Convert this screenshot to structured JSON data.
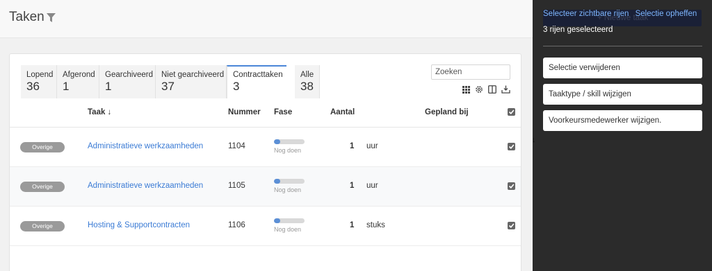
{
  "header": {
    "title": "Taken"
  },
  "tabs": [
    {
      "label": "Lopend",
      "count": "36"
    },
    {
      "label": "Afgerond",
      "count": "1"
    },
    {
      "label": "Gearchiveerd",
      "count": "1"
    },
    {
      "label": "Niet gearchiveerd",
      "count": "37"
    },
    {
      "label": "Contracttaken",
      "count": "3"
    },
    {
      "label": "Alle",
      "count": "38"
    }
  ],
  "active_tab": "Contracttaken",
  "search": {
    "placeholder": "Zoeken",
    "value": ""
  },
  "toolbar_icons": [
    "grid-icon",
    "gear-icon",
    "columns-icon",
    "export-icon"
  ],
  "table": {
    "headers": {
      "taak": "Taak ↓",
      "nummer": "Nummer",
      "fase": "Fase",
      "aantal": "Aantal",
      "gepland": "Gepland bij"
    },
    "rows": [
      {
        "badge": "Overige",
        "taak": "Administratieve werkzaamheden",
        "nummer": "1104",
        "fase": "Nog doen",
        "progress": 0.2,
        "aantal": "1",
        "eenheid": "uur",
        "checked": true
      },
      {
        "badge": "Overige",
        "taak": "Administratieve werkzaamheden",
        "nummer": "1105",
        "fase": "Nog doen",
        "progress": 0.2,
        "aantal": "1",
        "eenheid": "uur",
        "checked": true
      },
      {
        "badge": "Overige",
        "taak": "Hosting & Supportcontracten",
        "nummer": "1106",
        "fase": "Nog doen",
        "progress": 0.2,
        "aantal": "1",
        "eenheid": "stuks",
        "checked": true
      }
    ]
  },
  "panel": {
    "hidden_button": "+ Nieuwe taak",
    "select_visible": "Selecteer zichtbare rijen",
    "deselect": "Selectie opheffen",
    "selection_count": "3 rijen geselecteerd",
    "actions": [
      "Selectie verwijderen",
      "Taaktype / skill wijzigen",
      "Voorkeursmedewerker wijzigen."
    ]
  },
  "colors": {
    "accent": "#3a7bd5",
    "panel_bg": "#2b2b2b",
    "link": "#7eb6ff",
    "badge": "#9a9a9a"
  }
}
